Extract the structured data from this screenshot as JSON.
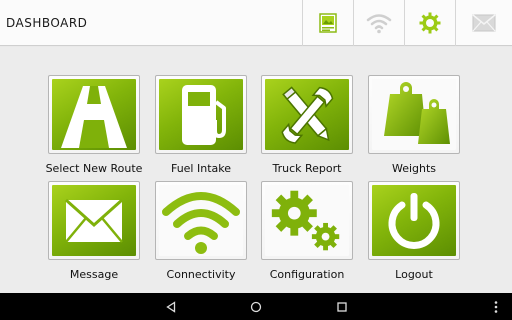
{
  "header": {
    "title": "DASHBOARD",
    "buttons": [
      {
        "name": "map-view",
        "icon": "map-document-icon"
      },
      {
        "name": "wifi",
        "icon": "wifi-icon"
      },
      {
        "name": "settings",
        "icon": "gear-icon"
      },
      {
        "name": "messages",
        "icon": "envelope-icon"
      }
    ]
  },
  "tiles": [
    {
      "label": "Select New Route",
      "icon": "road-icon"
    },
    {
      "label": "Fuel Intake",
      "icon": "fuel-pump-icon"
    },
    {
      "label": "Truck Report",
      "icon": "tools-pencil-icon"
    },
    {
      "label": "Weights",
      "icon": "weights-icon"
    },
    {
      "label": "Message",
      "icon": "envelope-icon"
    },
    {
      "label": "Connectivity",
      "icon": "wifi-icon"
    },
    {
      "label": "Configuration",
      "icon": "gears-icon"
    },
    {
      "label": "Logout",
      "icon": "power-icon"
    }
  ],
  "navbar": {
    "buttons": [
      "back",
      "home",
      "recents",
      "more"
    ]
  },
  "colors": {
    "accent": "#7fb10a",
    "accent_light": "#a9d21d",
    "accent_dark": "#5c8e02"
  }
}
